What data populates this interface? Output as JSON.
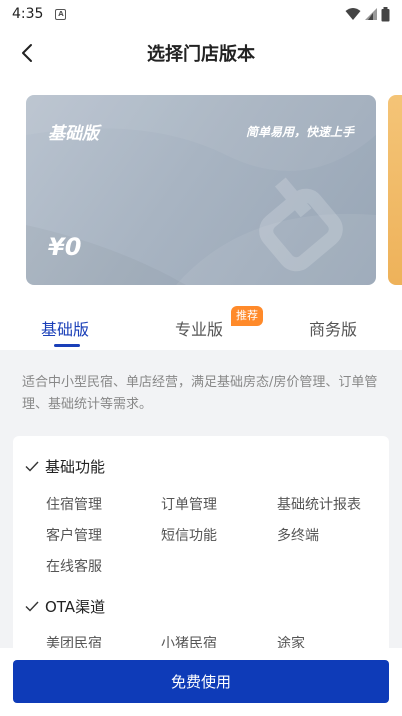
{
  "status_bar": {
    "time": "4:35",
    "notif_letter": "A"
  },
  "header": {
    "title": "选择门店版本"
  },
  "card": {
    "name": "基础版",
    "slogan": "简单易用，快速上手",
    "price": "¥0"
  },
  "tabs": [
    {
      "label": "基础版"
    },
    {
      "label": "专业版",
      "badge": "推荐"
    },
    {
      "label": "商务版"
    }
  ],
  "description": "适合中小型民宿、单店经营，满足基础房态/房价管理、订单管理、基础统计等需求。",
  "sections": [
    {
      "title": "基础功能",
      "items": [
        "住宿管理",
        "订单管理",
        "基础统计报表",
        "客户管理",
        "短信功能",
        "多终端",
        "在线客服"
      ]
    },
    {
      "title": "OTA渠道",
      "items": [
        "美团民宿",
        "小猪民宿",
        "途家"
      ]
    }
  ],
  "cta": {
    "label": "免费使用"
  },
  "colors": {
    "accent": "#1a3fb8",
    "button": "#0e3bb8",
    "badge": "#ff8a2a",
    "card": "#a8b4c2"
  }
}
